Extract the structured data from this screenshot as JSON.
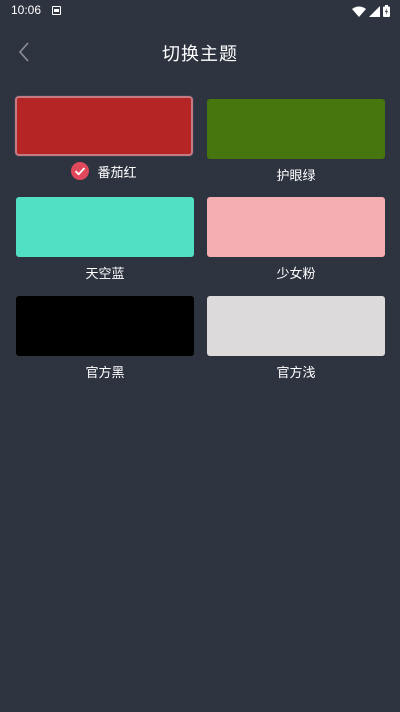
{
  "status_bar": {
    "time": "10:06"
  },
  "header": {
    "title": "切换主题"
  },
  "colors": {
    "background": "#2e3340",
    "check": "#e0485c"
  },
  "themes": [
    {
      "label": "番茄红",
      "color": "#b52525",
      "selected": true
    },
    {
      "label": "护眼绿",
      "color": "#47760f",
      "selected": false
    },
    {
      "label": "天空蓝",
      "color": "#52e0c4",
      "selected": false
    },
    {
      "label": "少女粉",
      "color": "#f4adb0",
      "selected": false
    },
    {
      "label": "官方黑",
      "color": "#000000",
      "selected": false
    },
    {
      "label": "官方浅",
      "color": "#dddadb",
      "selected": false
    }
  ]
}
